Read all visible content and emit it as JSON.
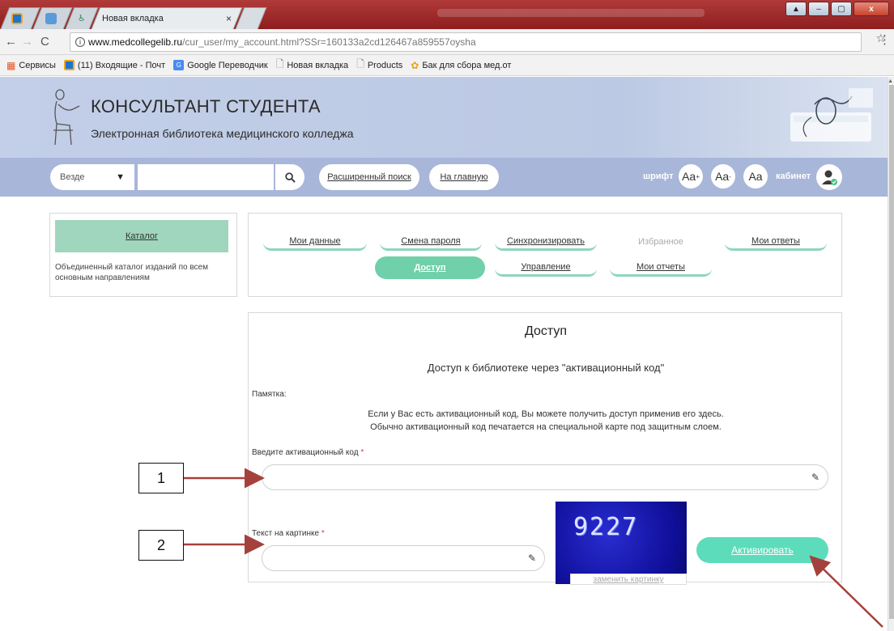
{
  "browser": {
    "tabs": [
      {
        "label": "",
        "icon": "mail-icon"
      },
      {
        "label": "",
        "icon": "extension-icon"
      },
      {
        "label": "",
        "icon": "figure-icon"
      },
      {
        "label": "Новая вкладка",
        "icon": "page-icon"
      }
    ],
    "active_tab_close": "×",
    "window_controls": {
      "minimize": "–",
      "maximize": "▢",
      "close": "x"
    },
    "address": {
      "domain": "www.medcollegelib.ru",
      "path": "/cur_user/my_account.html?SSr=160133a2cd126467a859557oysha"
    },
    "bookmarks": [
      {
        "label": "Сервисы",
        "icon": "apps-grid-icon",
        "color": "#e35b2c"
      },
      {
        "label": "(11) Входящие - Почт",
        "icon": "mail-icon",
        "color": "#1a73c9"
      },
      {
        "label": "Google Переводчик",
        "icon": "translate-icon",
        "color": "#4a8af4"
      },
      {
        "label": "Новая вкладка",
        "icon": "page-icon",
        "color": "#999999"
      },
      {
        "label": "Products",
        "icon": "page-icon",
        "color": "#999999"
      },
      {
        "label": "Бак для сбора мед.от",
        "icon": "flower-icon",
        "color": "#e8a21c"
      }
    ]
  },
  "site": {
    "title": "КОНСУЛЬТАНТ СТУДЕНТА",
    "subtitle": "Электронная библиотека медицинского колледжа"
  },
  "searchbar": {
    "scope": "Везде",
    "search_placeholder": "",
    "advanced_link": "Расширенный поиск",
    "home_link": "На главную",
    "font_label": "шрифт",
    "font_buttons": [
      "Aa",
      "Aa",
      "Aa"
    ],
    "cabinet_label": "кабинет"
  },
  "catalog": {
    "title": "Каталог",
    "description": "Объединенный каталог изданий по всем основным направлениям"
  },
  "account_nav": {
    "row1": [
      "Мои данные",
      "Смена пароля",
      "Синхронизировать",
      "Избранное",
      "Мои ответы"
    ],
    "row2": [
      "Доступ",
      "Управление",
      "Мои отчеты"
    ]
  },
  "access": {
    "title": "Доступ",
    "subtitle": "Доступ к библиотеке через \"активационный код\"",
    "memo_label": "Памятка:",
    "memo_line1": "Если у Вас есть активационный код, Вы можете получить доступ применив его здесь.",
    "memo_line2": "Обычно активационный код печатается на специальной карте под защитным слоем.",
    "code_label": "Введите активационный код",
    "captcha_label": "Текст на картинке",
    "required_mark": "*",
    "captcha_value": "9227",
    "captcha_refresh": "заменить картинку",
    "activate_button": "Активировать"
  },
  "annotations": {
    "callout_1": "1",
    "callout_2": "2",
    "arrow_color": "#a5413c"
  }
}
